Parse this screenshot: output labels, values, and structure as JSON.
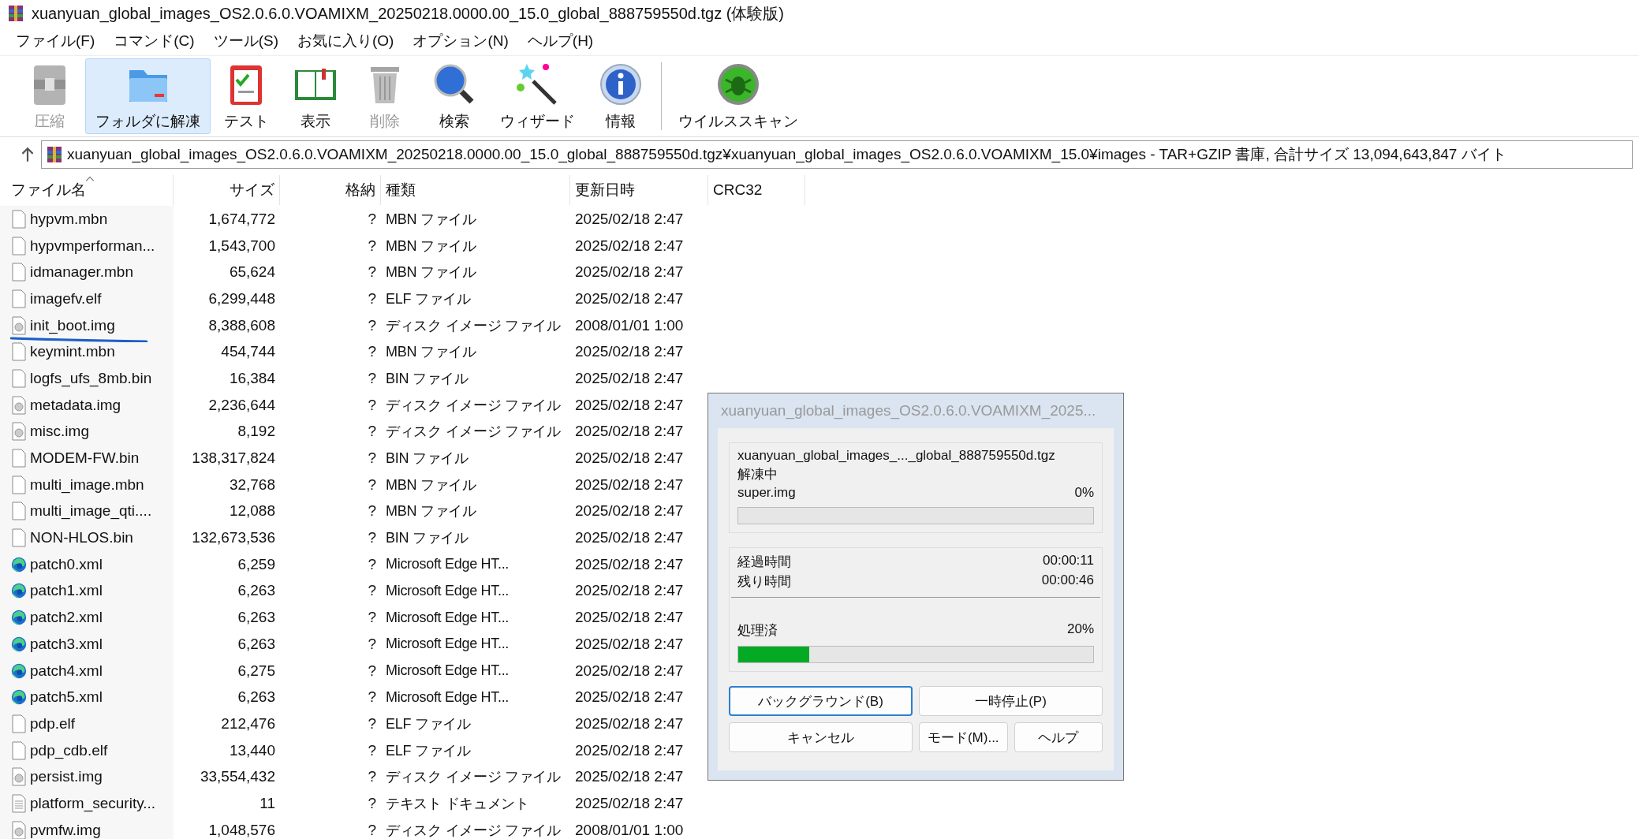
{
  "window": {
    "title": "xuanyuan_global_images_OS2.0.6.0.VOAMIXM_20250218.0000.00_15.0_global_888759550d.tgz (体験版)"
  },
  "menu": [
    "ファイル(F)",
    "コマンド(C)",
    "ツール(S)",
    "お気に入り(O)",
    "オプション(N)",
    "ヘルプ(H)"
  ],
  "toolbar": [
    {
      "label": "圧縮",
      "kind": "archive",
      "disabled": true,
      "selected": false
    },
    {
      "label": "フォルダに解凍",
      "kind": "extract",
      "disabled": false,
      "selected": true
    },
    {
      "label": "テスト",
      "kind": "test",
      "disabled": false,
      "selected": false
    },
    {
      "label": "表示",
      "kind": "view",
      "disabled": false,
      "selected": false
    },
    {
      "label": "削除",
      "kind": "delete",
      "disabled": true,
      "selected": false
    },
    {
      "label": "検索",
      "kind": "find",
      "disabled": false,
      "selected": false
    },
    {
      "label": "ウィザード",
      "kind": "wizard",
      "disabled": false,
      "selected": false
    },
    {
      "label": "情報",
      "kind": "info",
      "disabled": false,
      "selected": false
    },
    {
      "label": "ウイルススキャン",
      "kind": "virus",
      "disabled": false,
      "selected": false
    }
  ],
  "address_bar": {
    "path": "xuanyuan_global_images_OS2.0.6.0.VOAMIXM_20250218.0000.00_15.0_global_888759550d.tgz¥xuanyuan_global_images_OS2.0.6.0.VOAMIXM_15.0¥images - TAR+GZIP 書庫, 合計サイズ 13,094,643,847 バイト"
  },
  "table": {
    "columns": [
      {
        "label": "ファイル名",
        "sorted": true
      },
      {
        "label": "サイズ",
        "sorted": false
      },
      {
        "label": "格納",
        "sorted": false
      },
      {
        "label": "種類",
        "sorted": false
      },
      {
        "label": "更新日時",
        "sorted": false
      },
      {
        "label": "CRC32",
        "sorted": false
      }
    ],
    "rows": [
      {
        "kind": "file",
        "name": "hypvm.mbn",
        "size": "1,674,772",
        "packed": "?",
        "type": "MBN ファイル",
        "modified": "2025/02/18 2:47",
        "underlined": false
      },
      {
        "kind": "file",
        "name": "hypvmperforman...",
        "size": "1,543,700",
        "packed": "?",
        "type": "MBN ファイル",
        "modified": "2025/02/18 2:47",
        "underlined": false
      },
      {
        "kind": "file",
        "name": "idmanager.mbn",
        "size": "65,624",
        "packed": "?",
        "type": "MBN ファイル",
        "modified": "2025/02/18 2:47",
        "underlined": false
      },
      {
        "kind": "file",
        "name": "imagefv.elf",
        "size": "6,299,448",
        "packed": "?",
        "type": "ELF ファイル",
        "modified": "2025/02/18 2:47",
        "underlined": false
      },
      {
        "kind": "disk",
        "name": "init_boot.img",
        "size": "8,388,608",
        "packed": "?",
        "type": "ディスク イメージ ファイル",
        "modified": "2008/01/01 1:00",
        "underlined": true
      },
      {
        "kind": "file",
        "name": "keymint.mbn",
        "size": "454,744",
        "packed": "?",
        "type": "MBN ファイル",
        "modified": "2025/02/18 2:47",
        "underlined": false
      },
      {
        "kind": "file",
        "name": "logfs_ufs_8mb.bin",
        "size": "16,384",
        "packed": "?",
        "type": "BIN ファイル",
        "modified": "2025/02/18 2:47",
        "underlined": false
      },
      {
        "kind": "disk",
        "name": "metadata.img",
        "size": "2,236,644",
        "packed": "?",
        "type": "ディスク イメージ ファイル",
        "modified": "2025/02/18 2:47",
        "underlined": false
      },
      {
        "kind": "disk",
        "name": "misc.img",
        "size": "8,192",
        "packed": "?",
        "type": "ディスク イメージ ファイル",
        "modified": "2025/02/18 2:47",
        "underlined": false
      },
      {
        "kind": "file",
        "name": "MODEM-FW.bin",
        "size": "138,317,824",
        "packed": "?",
        "type": "BIN ファイル",
        "modified": "2025/02/18 2:47",
        "underlined": false
      },
      {
        "kind": "file",
        "name": "multi_image.mbn",
        "size": "32,768",
        "packed": "?",
        "type": "MBN ファイル",
        "modified": "2025/02/18 2:47",
        "underlined": false
      },
      {
        "kind": "file",
        "name": "multi_image_qti....",
        "size": "12,088",
        "packed": "?",
        "type": "MBN ファイル",
        "modified": "2025/02/18 2:47",
        "underlined": false
      },
      {
        "kind": "file",
        "name": "NON-HLOS.bin",
        "size": "132,673,536",
        "packed": "?",
        "type": "BIN ファイル",
        "modified": "2025/02/18 2:47",
        "underlined": false
      },
      {
        "kind": "edge",
        "name": "patch0.xml",
        "size": "6,259",
        "packed": "?",
        "type": "Microsoft Edge HT...",
        "modified": "2025/02/18 2:47",
        "underlined": false
      },
      {
        "kind": "edge",
        "name": "patch1.xml",
        "size": "6,263",
        "packed": "?",
        "type": "Microsoft Edge HT...",
        "modified": "2025/02/18 2:47",
        "underlined": false
      },
      {
        "kind": "edge",
        "name": "patch2.xml",
        "size": "6,263",
        "packed": "?",
        "type": "Microsoft Edge HT...",
        "modified": "2025/02/18 2:47",
        "underlined": false
      },
      {
        "kind": "edge",
        "name": "patch3.xml",
        "size": "6,263",
        "packed": "?",
        "type": "Microsoft Edge HT...",
        "modified": "2025/02/18 2:47",
        "underlined": false
      },
      {
        "kind": "edge",
        "name": "patch4.xml",
        "size": "6,275",
        "packed": "?",
        "type": "Microsoft Edge HT...",
        "modified": "2025/02/18 2:47",
        "underlined": false
      },
      {
        "kind": "edge",
        "name": "patch5.xml",
        "size": "6,263",
        "packed": "?",
        "type": "Microsoft Edge HT...",
        "modified": "2025/02/18 2:47",
        "underlined": false
      },
      {
        "kind": "file",
        "name": "pdp.elf",
        "size": "212,476",
        "packed": "?",
        "type": "ELF ファイル",
        "modified": "2025/02/18 2:47",
        "underlined": false
      },
      {
        "kind": "file",
        "name": "pdp_cdb.elf",
        "size": "13,440",
        "packed": "?",
        "type": "ELF ファイル",
        "modified": "2025/02/18 2:47",
        "underlined": false
      },
      {
        "kind": "disk",
        "name": "persist.img",
        "size": "33,554,432",
        "packed": "?",
        "type": "ディスク イメージ ファイル",
        "modified": "2025/02/18 2:47",
        "underlined": false
      },
      {
        "kind": "text",
        "name": "platform_security...",
        "size": "11",
        "packed": "?",
        "type": "テキスト ドキュメント",
        "modified": "2025/02/18 2:47",
        "underlined": false
      },
      {
        "kind": "disk",
        "name": "pvmfw.img",
        "size": "1,048,576",
        "packed": "?",
        "type": "ディスク イメージ ファイル",
        "modified": "2008/01/01 1:00",
        "underlined": false
      }
    ]
  },
  "progress_dialog": {
    "title": "xuanyuan_global_images_OS2.0.6.0.VOAMIXM_2025...",
    "archive": "xuanyuan_global_images_..._global_888759550d.tgz",
    "status": "解凍中",
    "file_progress": {
      "file": "super.img",
      "percent": "0%"
    },
    "elapsed_label": "経過時間",
    "elapsed": "00:00:11",
    "remaining_label": "残り時間",
    "remaining": "00:00:46",
    "total_progress": {
      "label": "処理済",
      "percent": "20%",
      "level": 0.2
    },
    "buttons": [
      {
        "label": "バックグラウンド(B)",
        "focused": true
      },
      {
        "label": "一時停止(P)",
        "focused": false
      },
      {
        "label": "キャンセル",
        "focused": false
      },
      {
        "label": "モード(M)...",
        "focused": false
      },
      {
        "label": "ヘルプ",
        "focused": false
      }
    ]
  }
}
